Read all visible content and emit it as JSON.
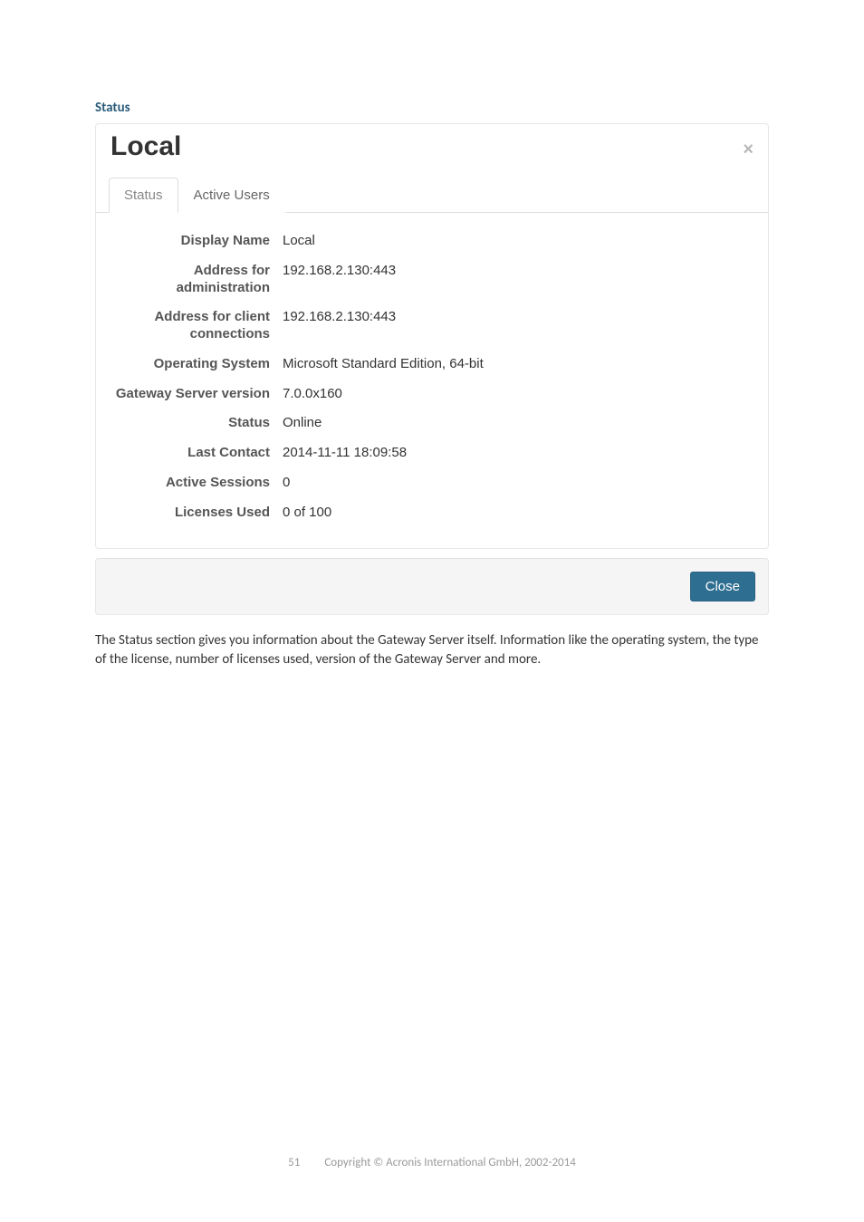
{
  "section_heading": "Status",
  "dialog": {
    "title": "Local",
    "tabs": [
      {
        "label": "Status",
        "active": true
      },
      {
        "label": "Active Users",
        "active": false
      }
    ],
    "rows": [
      {
        "key": "Display Name",
        "val": "Local"
      },
      {
        "key": "Address for administration",
        "val": "192.168.2.130:443"
      },
      {
        "key": "Address for client connections",
        "val": "192.168.2.130:443"
      },
      {
        "key": "Operating System",
        "val": "Microsoft Standard Edition, 64-bit"
      },
      {
        "key": "Gateway Server version",
        "val": "7.0.0x160"
      },
      {
        "key": "Status",
        "val": "Online"
      },
      {
        "key": "Last Contact",
        "val": "2014-11-11 18:09:58"
      },
      {
        "key": "Active Sessions",
        "val": "0"
      },
      {
        "key": "Licenses Used",
        "val": "0 of 100"
      }
    ],
    "close_button": "Close"
  },
  "paragraph": "The Status section gives you information about the Gateway Server itself. Information like the operating system, the type of the license, number of licenses used, version of the Gateway Server and more.",
  "footer": {
    "page": "51",
    "copyright": "Copyright © Acronis International GmbH, 2002-2014"
  }
}
